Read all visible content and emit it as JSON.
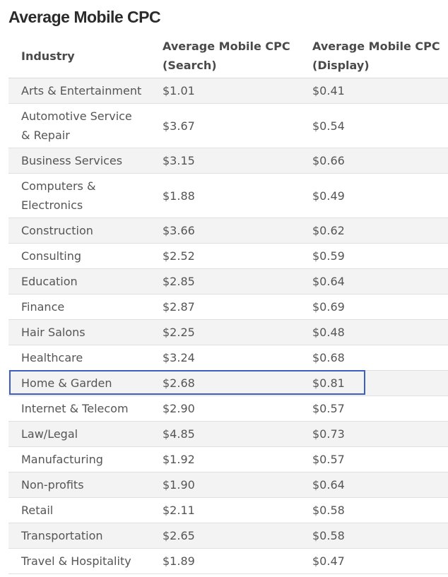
{
  "title": "Average Mobile CPC",
  "table": {
    "headers": [
      "Industry",
      "Average Mobile CPC (Search)",
      "Average Mobile CPC (Display)"
    ],
    "rows": [
      [
        "Arts & Entertainment",
        "$1.01",
        "$0.41"
      ],
      [
        "Automotive Service & Repair",
        "$3.67",
        "$0.54"
      ],
      [
        "Business Services",
        "$3.15",
        "$0.66"
      ],
      [
        "Computers & Electronics",
        "$1.88",
        "$0.49"
      ],
      [
        "Construction",
        "$3.66",
        "$0.62"
      ],
      [
        "Consulting",
        "$2.52",
        "$0.59"
      ],
      [
        "Education",
        "$2.85",
        "$0.64"
      ],
      [
        "Finance",
        "$2.87",
        "$0.69"
      ],
      [
        "Hair Salons",
        "$2.25",
        "$0.48"
      ],
      [
        "Healthcare",
        "$3.24",
        "$0.68"
      ],
      [
        "Home & Garden",
        "$2.68",
        "$0.81"
      ],
      [
        "Internet & Telecom",
        "$2.90",
        "$0.57"
      ],
      [
        "Law/Legal",
        "$4.85",
        "$0.73"
      ],
      [
        "Manufacturing",
        "$1.92",
        "$0.57"
      ],
      [
        "Non-profits",
        "$1.90",
        "$0.64"
      ],
      [
        "Retail",
        "$2.11",
        "$0.58"
      ],
      [
        "Transportation",
        "$2.65",
        "$0.58"
      ],
      [
        "Travel & Hospitality",
        "$1.89",
        "$0.47"
      ]
    ],
    "highlighted_row": 10
  },
  "colors": {
    "highlight_border": "#3d5fc4",
    "stripe": "#f3f3f3"
  }
}
